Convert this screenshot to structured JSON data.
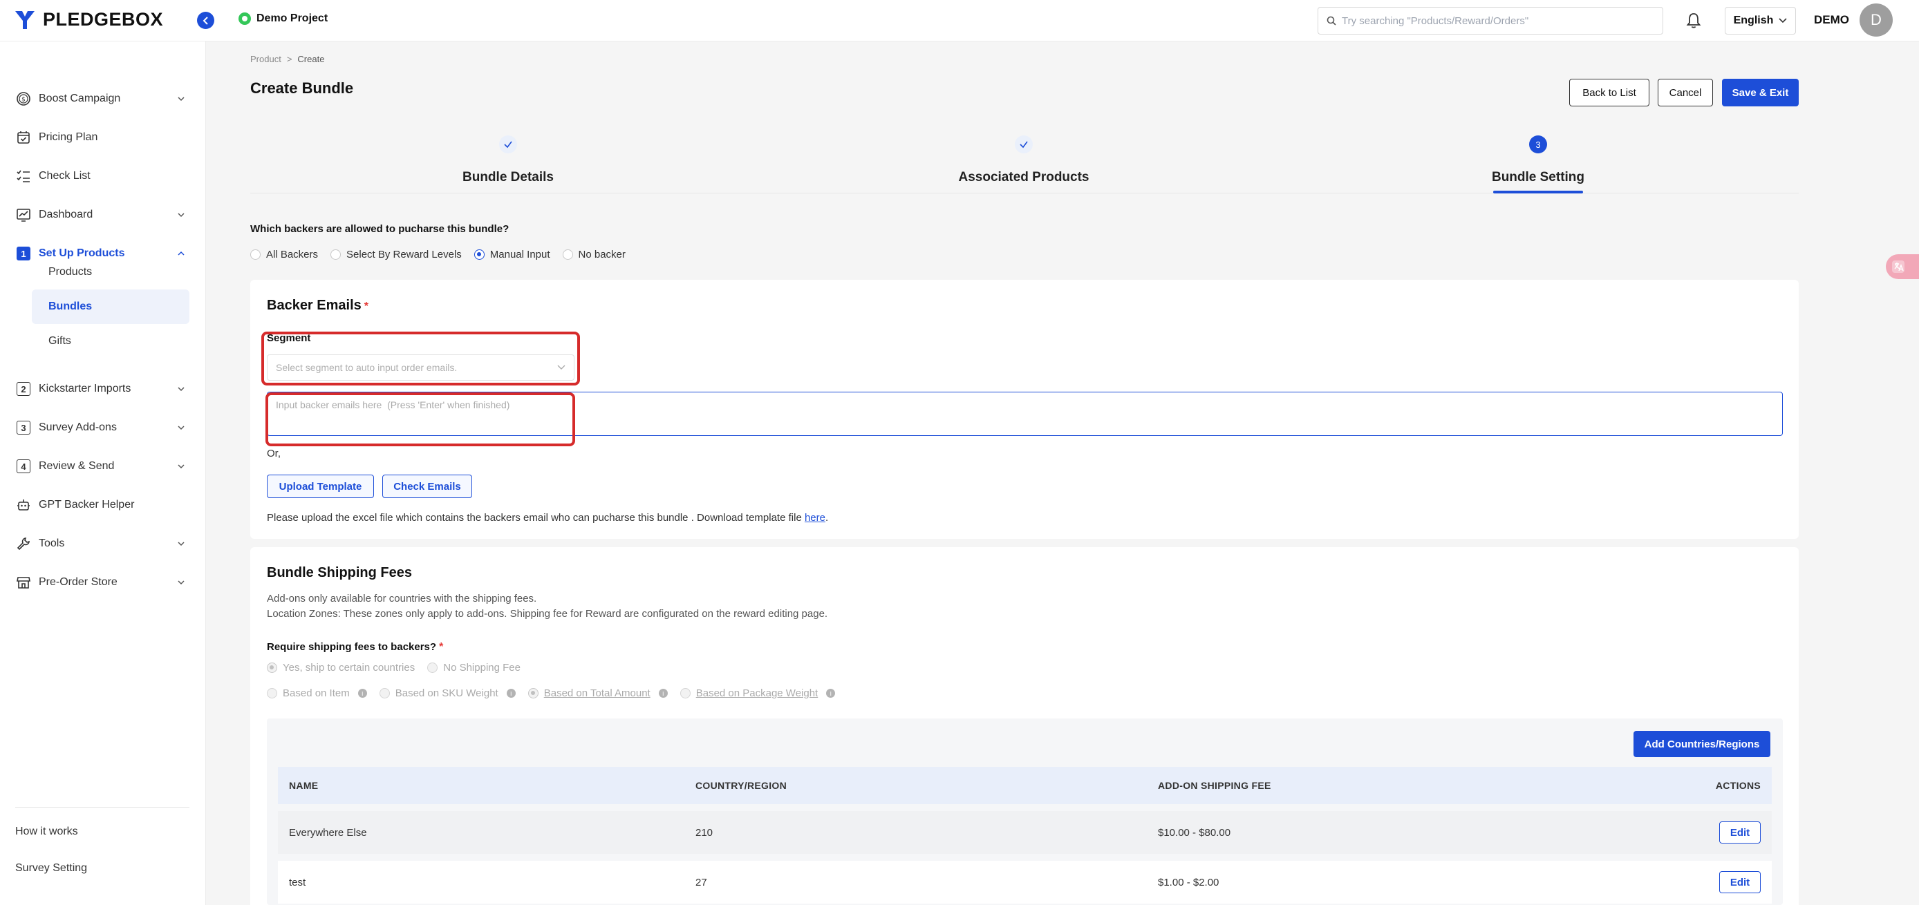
{
  "header": {
    "brand": "PLEDGEBOX",
    "project_name": "Demo Project",
    "search_placeholder": "Try searching \"Products/Reward/Orders\"",
    "language": "English",
    "user_name": "DEMO",
    "avatar_initial": "D"
  },
  "sidebar": {
    "items": [
      {
        "label": "Boost Campaign"
      },
      {
        "label": "Pricing Plan"
      },
      {
        "label": "Check List"
      },
      {
        "label": "Dashboard"
      },
      {
        "label": "Set Up Products",
        "number": "1"
      },
      {
        "label": "Kickstarter Imports",
        "number": "2"
      },
      {
        "label": "Survey Add-ons",
        "number": "3"
      },
      {
        "label": "Review & Send",
        "number": "4"
      },
      {
        "label": "GPT Backer Helper"
      },
      {
        "label": "Tools"
      },
      {
        "label": "Pre-Order Store"
      }
    ],
    "sub_items": [
      {
        "label": "Products"
      },
      {
        "label": "Bundles"
      },
      {
        "label": "Gifts"
      }
    ],
    "footer": [
      {
        "label": "How it works"
      },
      {
        "label": "Survey Setting"
      }
    ]
  },
  "breadcrumb": {
    "root": "Product",
    "sep": ">",
    "current": "Create"
  },
  "page_title": "Create Bundle",
  "actions": {
    "back": "Back to List",
    "cancel": "Cancel",
    "save": "Save & Exit"
  },
  "steps": [
    {
      "label": "Bundle Details",
      "status": "done"
    },
    {
      "label": "Associated Products",
      "status": "done"
    },
    {
      "label": "Bundle Setting",
      "status": "current",
      "number": "3"
    }
  ],
  "backer_question": "Which backers are allowed to pucharse this bundle?",
  "backer_options": [
    {
      "label": "All Backers",
      "checked": false
    },
    {
      "label": "Select By Reward Levels",
      "checked": false
    },
    {
      "label": "Manual Input",
      "checked": true
    },
    {
      "label": "No backer",
      "checked": false
    }
  ],
  "backer_emails": {
    "title": "Backer Emails",
    "required_mark": "*",
    "segment_label": "Segment",
    "segment_placeholder": "Select segment to auto input order emails.",
    "email_placeholder": "Input backer emails here  (Press 'Enter' when finished)",
    "or_text": "Or,",
    "upload_label": "Upload Template",
    "check_label": "Check Emails",
    "upload_note": "Please upload the excel file which contains the backers email who can pucharse this bundle . Download template file ",
    "upload_link": "here",
    "upload_note_end": "."
  },
  "shipping": {
    "title": "Bundle Shipping Fees",
    "note1": "Add-ons only available for countries with the shipping fees.",
    "note2": "Location Zones: These zones only apply to add-ons. Shipping fee for Reward are configurated on the reward editing page.",
    "question": "Require shipping fees to backers?",
    "required_mark": "*",
    "require_options": [
      {
        "label": "Yes, ship to certain countries",
        "checked": true
      },
      {
        "label": "No Shipping Fee",
        "checked": false
      }
    ],
    "basis_options": [
      {
        "label": "Based on Item",
        "checked": false
      },
      {
        "label": "Based on SKU Weight",
        "checked": false
      },
      {
        "label": "Based on Total Amount",
        "checked": true
      },
      {
        "label": "Based on Package Weight",
        "checked": false
      }
    ],
    "info_glyph": "i",
    "add_label": "Add Countries/Regions",
    "columns": [
      "NAME",
      "COUNTRY/REGION",
      "ADD-ON SHIPPING FEE",
      "ACTIONS"
    ],
    "rows": [
      {
        "name": "Everywhere Else",
        "count": "210",
        "fee": "$10.00 - $80.00",
        "action": "Edit"
      },
      {
        "name": "test",
        "count": "27",
        "fee": "$1.00 - $2.00",
        "action": "Edit"
      }
    ]
  },
  "colors": {
    "accent": "#1d4ed8",
    "highlight": "#d62b2b"
  }
}
